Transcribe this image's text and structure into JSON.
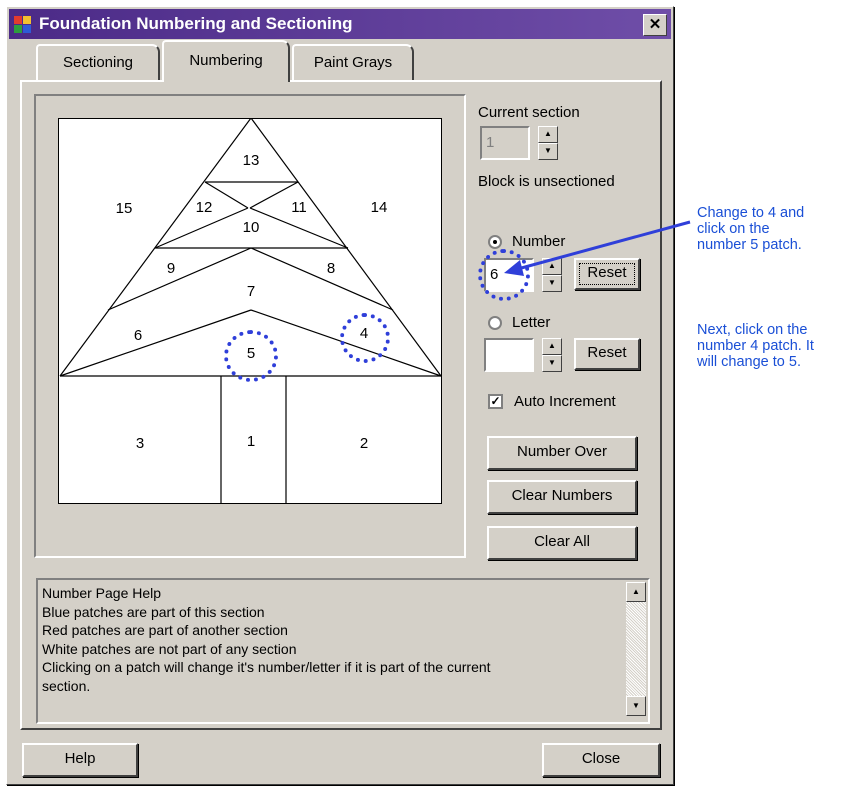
{
  "window": {
    "title": "Foundation Numbering and Sectioning",
    "close_glyph": "✕"
  },
  "tabs": [
    {
      "label": "Sectioning",
      "active": false
    },
    {
      "label": "Numbering",
      "active": true
    },
    {
      "label": "Paint Grays",
      "active": false
    }
  ],
  "block": {
    "patch_numbers": [
      "13",
      "15",
      "12",
      "11",
      "14",
      "10",
      "9",
      "8",
      "7",
      "6",
      "4",
      "5",
      "3",
      "1",
      "2"
    ]
  },
  "controls": {
    "current_section_label": "Current section",
    "current_section_value": "1",
    "block_status": "Block is unsectioned",
    "number_radio_label": "Number",
    "number_value": "6",
    "reset_label": "Reset",
    "letter_radio_label": "Letter",
    "letter_value": "",
    "reset2_label": "Reset",
    "auto_increment_label": "Auto Increment",
    "auto_increment_checked": true,
    "number_over_label": "Number Over",
    "clear_numbers_label": "Clear Numbers",
    "clear_all_label": "Clear All"
  },
  "help": {
    "lines": [
      "Number Page Help",
      "Blue patches are part of this section",
      "Red patches are part of another section",
      "White patches are not part of any section",
      "Clicking on a patch will change it's number/letter if it is part of the current",
      "section."
    ]
  },
  "footer": {
    "help_label": "Help",
    "close_label": "Close"
  },
  "annotations": {
    "note1": [
      "Change to 4 and",
      "click on the",
      "number 5 patch."
    ],
    "note2": [
      "Next, click on the",
      "number 4 patch. It",
      "will change to 5."
    ]
  },
  "colors": {
    "annotation_blue": "#1a4fd6",
    "title_bar": "#4b2a87",
    "dialog_face": "#d4d0c8"
  },
  "icons": [
    "app-icon",
    "close-icon",
    "spin-up-icon",
    "spin-down-icon",
    "scroll-up-icon",
    "scroll-down-icon",
    "arrow-icon"
  ]
}
